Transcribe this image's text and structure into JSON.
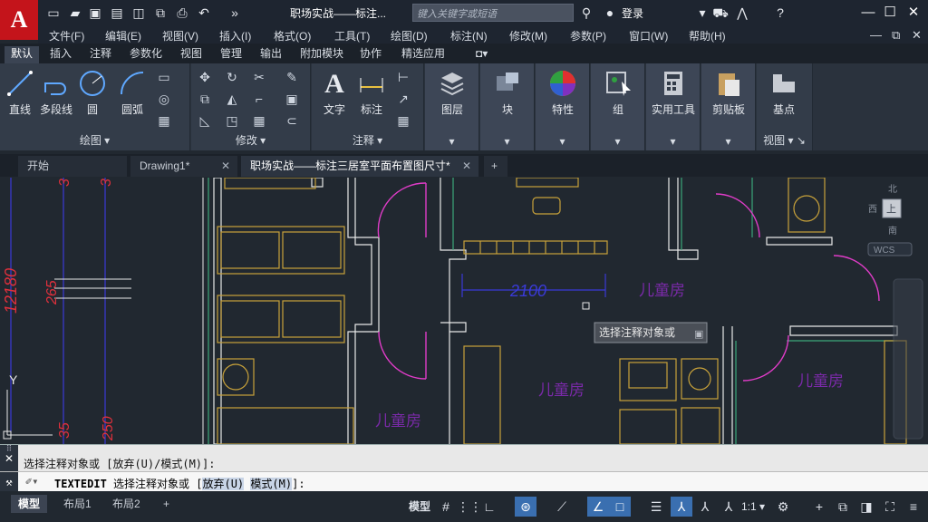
{
  "app": {
    "title": "职场实战——标注...",
    "search_placeholder": "键入关键字或短语",
    "login": "登录",
    "logo": "A"
  },
  "menu": [
    "文件(F)",
    "编辑(E)",
    "视图(V)",
    "插入(I)",
    "格式(O)",
    "工具(T)",
    "绘图(D)",
    "标注(N)",
    "修改(M)",
    "参数(P)",
    "窗口(W)",
    "帮助(H)"
  ],
  "ribbon_tabs": [
    "默认",
    "插入",
    "注释",
    "参数化",
    "视图",
    "管理",
    "输出",
    "附加模块",
    "协作",
    "精选应用"
  ],
  "ribbon": {
    "draw": {
      "label": "绘图",
      "line": "直线",
      "polyline": "多段线",
      "circle": "圆",
      "arc": "圆弧"
    },
    "modify": {
      "label": "修改"
    },
    "annotation": {
      "label": "注释",
      "text": "文字",
      "dimension": "标注"
    },
    "layer": "图层",
    "block": "块",
    "properties": "特性",
    "group": "组",
    "utilities": "实用工具",
    "clipboard": "剪贴板",
    "view": {
      "label": "视图",
      "base": "基点"
    }
  },
  "doc_tabs": [
    {
      "label": "开始"
    },
    {
      "label": "Drawing1*"
    },
    {
      "label": "职场实战——标注三居室平面布置图尺寸*"
    }
  ],
  "canvas": {
    "dims": {
      "d12180": "12180",
      "d265": "265",
      "d2100": "2100",
      "d250": "250",
      "d35": "35",
      "d3a": "3",
      "d3b": "3"
    },
    "rooms": [
      "儿童房",
      "儿童房",
      "儿童房",
      "儿童房"
    ],
    "tooltip": "选择注释对象或",
    "ucs_y": "Y",
    "viewcube": {
      "north": "北",
      "south": "南",
      "west": "西",
      "top": "上",
      "wcs": "WCS"
    }
  },
  "command": {
    "history": "选择注释对象或 [放弃(U)/模式(M)]:",
    "cmd_name": "TEXTEDIT",
    "prompt": "选择注释对象或 [",
    "opt1": "放弃(U)",
    "opt2": "模式(M)",
    "end": "]:"
  },
  "layouts": [
    "模型",
    "布局1",
    "布局2"
  ],
  "status": {
    "model": "模型",
    "scale": "1:1"
  },
  "colors": {
    "dim": "#e0303c",
    "dimline": "#3a3ad8",
    "wall": "#e8e8e8",
    "furniture": "#c8a23a",
    "door": "#e03cc8",
    "green": "#3ca87a",
    "text": "#7a2aa8"
  }
}
